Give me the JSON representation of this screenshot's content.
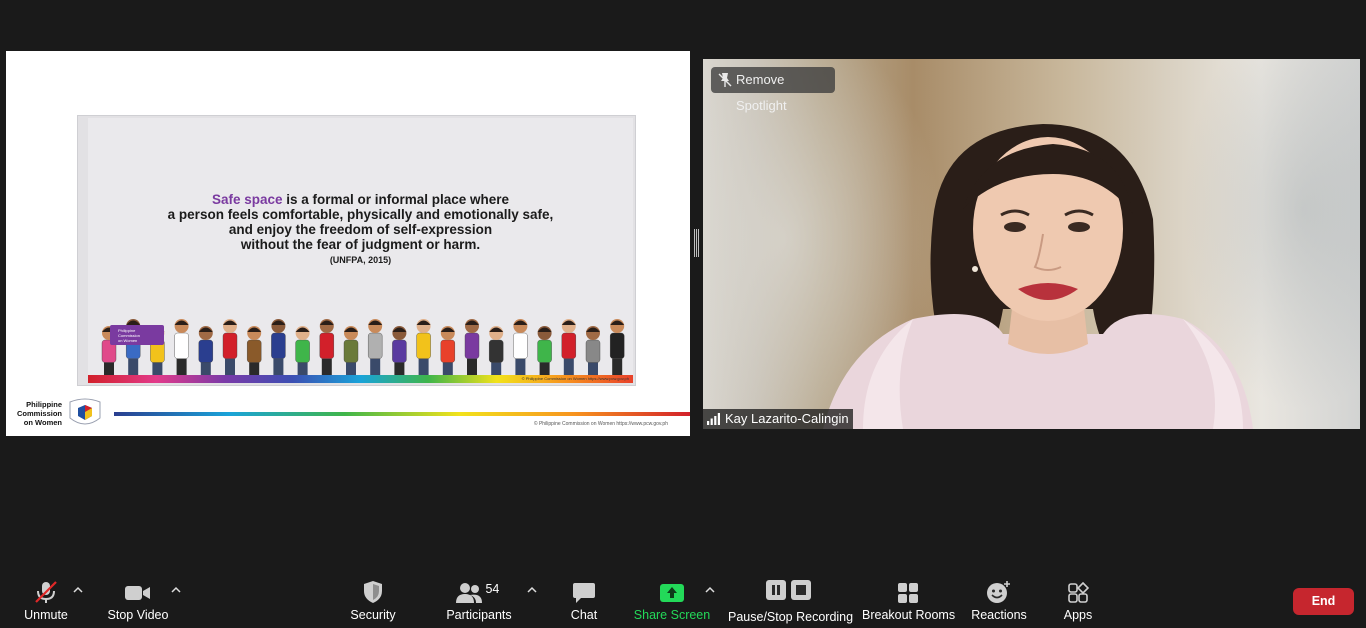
{
  "slide": {
    "highlight": "Safe space",
    "line1_rest": " is a formal or informal place where",
    "line2": "a person feels comfortable, physically and emotionally safe,",
    "line3": "and enjoy the freedom of self-expression",
    "line4": "without the fear of judgment or harm.",
    "citation": "(UNFPA, 2015)",
    "badge_line1": "Philippine",
    "badge_line2": "Commission",
    "badge_line3": "on Women",
    "strip_note": "© Philippine Commission on Women https://www.pcw.gov.ph",
    "footer_logo_line1": "Philippine",
    "footer_logo_line2": "Commission",
    "footer_logo_line3": "on Women",
    "footer_note": "© Philippine Commission on Women https://www.pcw.gov.ph"
  },
  "video": {
    "spotlight_label": "Remove Spotlight",
    "participant_name": "Kay Lazarito-Calingin"
  },
  "toolbar": {
    "unmute": "Unmute",
    "stop_video": "Stop Video",
    "security": "Security",
    "participants": "Participants",
    "participants_count": "54",
    "chat": "Chat",
    "share_screen": "Share Screen",
    "recording": "Pause/Stop Recording",
    "breakout": "Breakout Rooms",
    "reactions": "Reactions",
    "apps": "Apps",
    "end": "End"
  },
  "colors": {
    "share_green": "#23d959",
    "end_red": "#c6262e",
    "highlight_purple": "#7a3aa0",
    "mute_red": "#e02828"
  }
}
